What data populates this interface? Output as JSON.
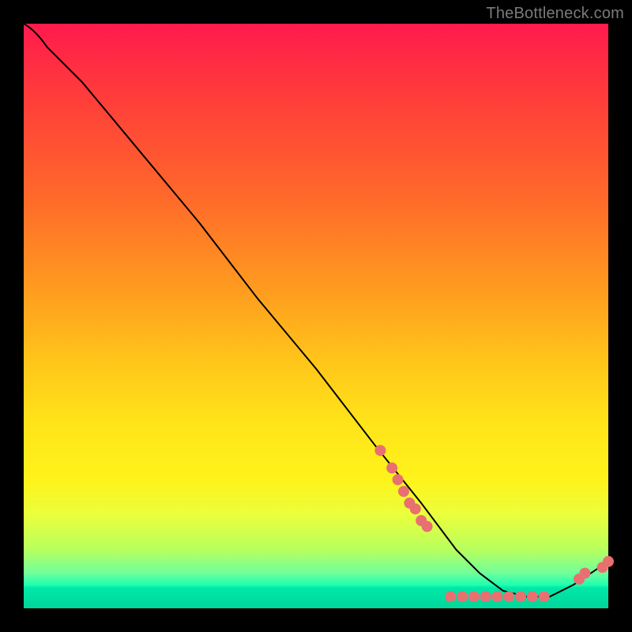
{
  "watermark": "TheBottleneck.com",
  "colors": {
    "bg": "#000000",
    "curve": "#000000",
    "dot": "#e87070",
    "gradient_top": "#ff1a4d",
    "gradient_bottom": "#00d69b"
  },
  "chart_data": {
    "type": "line",
    "title": "",
    "xlabel": "",
    "ylabel": "",
    "xlim": [
      0,
      100
    ],
    "ylim": [
      0,
      100
    ],
    "grid": false,
    "legend": false,
    "x": [
      0,
      4,
      10,
      20,
      30,
      40,
      50,
      60,
      68,
      74,
      78,
      82,
      86,
      90,
      94,
      100
    ],
    "y": [
      100,
      96,
      90,
      78,
      66,
      53,
      41,
      28,
      18,
      10,
      6,
      3,
      2,
      2,
      4,
      8
    ],
    "annotations": [
      {
        "x": 61,
        "y": 27
      },
      {
        "x": 63,
        "y": 24
      },
      {
        "x": 64,
        "y": 22
      },
      {
        "x": 65,
        "y": 20
      },
      {
        "x": 66,
        "y": 18
      },
      {
        "x": 67,
        "y": 17
      },
      {
        "x": 68,
        "y": 15
      },
      {
        "x": 69,
        "y": 14
      },
      {
        "x": 73,
        "y": 2
      },
      {
        "x": 75,
        "y": 2
      },
      {
        "x": 77,
        "y": 2
      },
      {
        "x": 79,
        "y": 2
      },
      {
        "x": 81,
        "y": 2
      },
      {
        "x": 83,
        "y": 2
      },
      {
        "x": 85,
        "y": 2
      },
      {
        "x": 87,
        "y": 2
      },
      {
        "x": 89,
        "y": 2
      },
      {
        "x": 95,
        "y": 5
      },
      {
        "x": 96,
        "y": 6
      },
      {
        "x": 99,
        "y": 7
      },
      {
        "x": 100,
        "y": 8
      }
    ]
  }
}
